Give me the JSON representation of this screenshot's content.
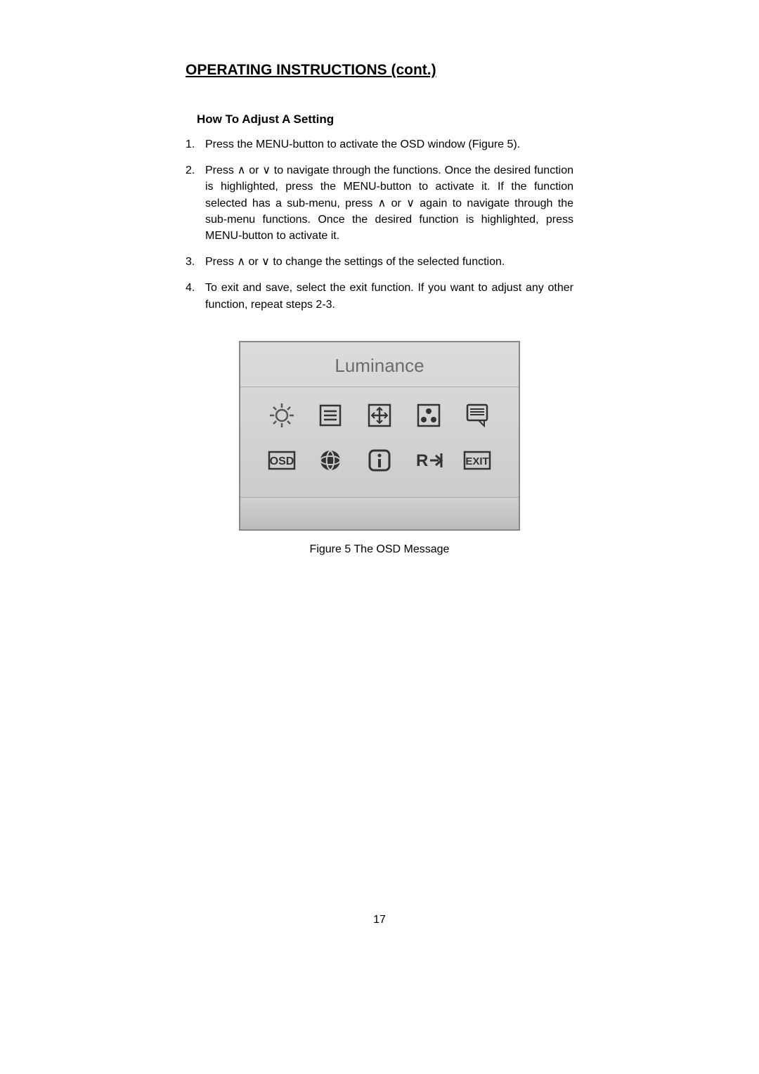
{
  "header": "OPERATING INSTRUCTIONS (cont.)",
  "subheader": "How To Adjust A Setting",
  "steps": [
    {
      "num": "1.",
      "text": "Press the MENU-button to activate the OSD window (Figure 5).",
      "justify": false
    },
    {
      "num": "2.",
      "text": "Press ∧ or ∨ to navigate through the functions. Once the desired function is highlighted, press the MENU-button  to activate it.  If the function selected has a sub-menu, press ∧ or ∨ again to navigate through the sub-menu functions.  Once the desired function is highlighted, press MENU-button to activate it.",
      "justify": true
    },
    {
      "num": "3.",
      "text": "Press ∧ or ∨ to change the settings of the selected function.",
      "justify": false
    },
    {
      "num": "4.",
      "text": "To exit and save, select the exit function. If you want to adjust any other function, repeat steps 2-3.",
      "justify": true
    }
  ],
  "osd": {
    "title": "Luminance",
    "row1": [
      {
        "name": "luminance-icon",
        "label": "Luminance"
      },
      {
        "name": "image-setup-icon",
        "label": "Image Setup"
      },
      {
        "name": "picture-boost-icon",
        "label": "Picture Boost"
      },
      {
        "name": "color-temp-icon",
        "label": "Color Temp"
      },
      {
        "name": "dcr-icon",
        "label": "DCR"
      }
    ],
    "row2": [
      {
        "name": "osd-setup-icon",
        "label": "OSD"
      },
      {
        "name": "extra-icon",
        "label": "Extra"
      },
      {
        "name": "information-icon",
        "label": "Information"
      },
      {
        "name": "reset-icon",
        "label": "Reset"
      },
      {
        "name": "exit-icon",
        "label": "EXIT"
      }
    ]
  },
  "figure_caption": "Figure 5    The  OSD  Message",
  "page_number": "17"
}
